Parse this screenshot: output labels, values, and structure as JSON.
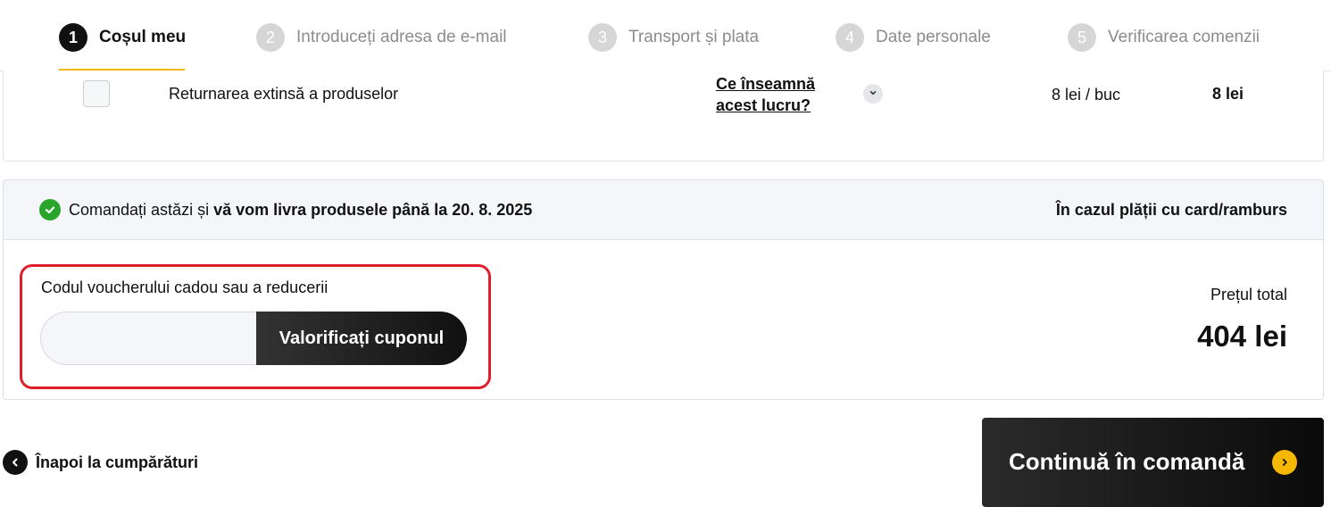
{
  "steps": [
    {
      "num": "1",
      "label": "Coșul meu",
      "active": true
    },
    {
      "num": "2",
      "label": "Introduceți adresa de e-mail",
      "active": false
    },
    {
      "num": "3",
      "label": "Transport și plata",
      "active": false
    },
    {
      "num": "4",
      "label": "Date personale",
      "active": false
    },
    {
      "num": "5",
      "label": "Verificarea comenzii",
      "active": false
    }
  ],
  "extended_return": {
    "name": "Returnarea extinsă a produselor",
    "info_link": "Ce înseamnă acest lucru?",
    "unit_price": "8 lei / buc",
    "price": "8 lei",
    "checked": false
  },
  "delivery": {
    "prefix": "Comandați astăzi și",
    "highlight": "vă vom livra produsele până la 20. 8. 2025",
    "payment_note": "În cazul plății cu card/ramburs"
  },
  "voucher": {
    "label": "Codul voucherului cadou sau a reducerii",
    "value": "",
    "button_label": "Valorificați cuponul"
  },
  "total": {
    "label": "Prețul total",
    "value": "404 lei"
  },
  "actions": {
    "back_label": "Înapoi la cumpărături",
    "continue_label": "Continuă în comandă"
  },
  "colors": {
    "accent": "#f5b800",
    "success": "#2aa52c",
    "highlight_border": "#e01e2b",
    "dark": "#111111"
  }
}
